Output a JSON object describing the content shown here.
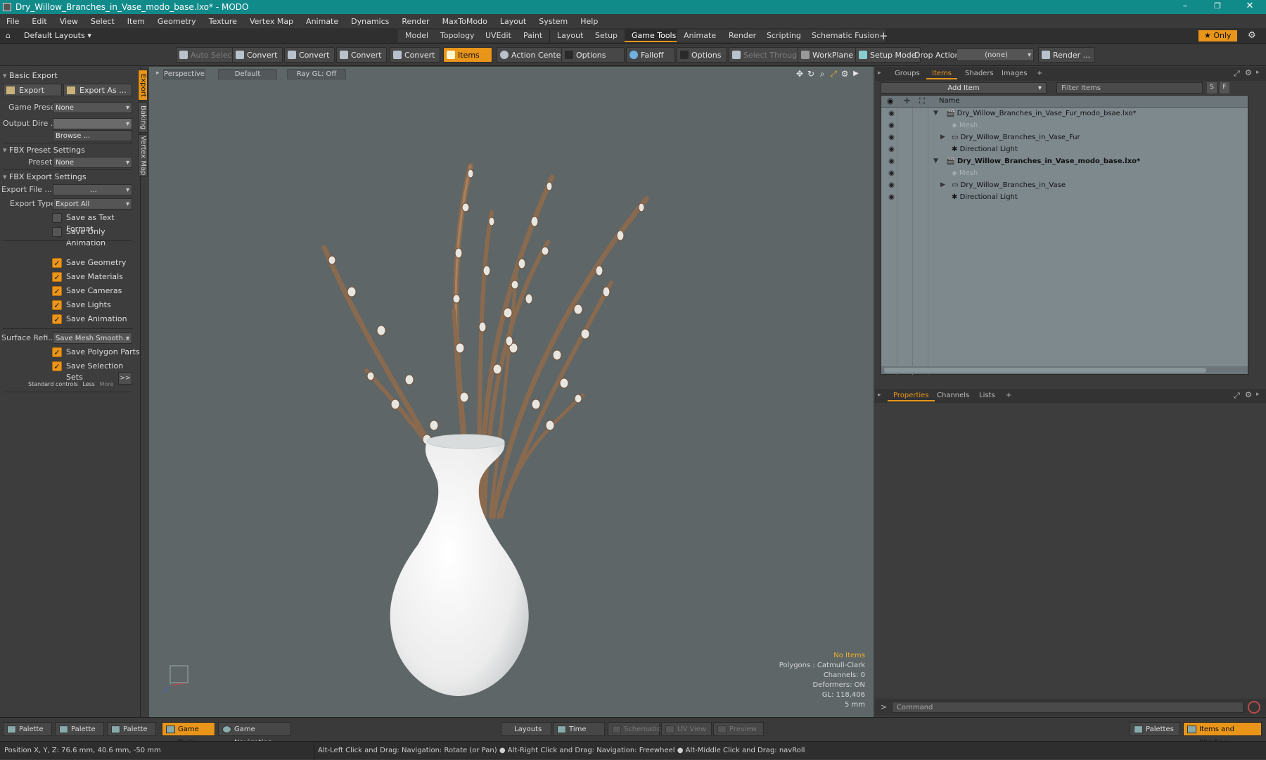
{
  "window": {
    "title": "Dry_Willow_Branches_in_Vase_modo_base.lxo* - MODO",
    "minimize": "–",
    "maximize": "❐",
    "close": "✕"
  },
  "menu": [
    "File",
    "Edit",
    "View",
    "Select",
    "Item",
    "Geometry",
    "Texture",
    "Vertex Map",
    "Animate",
    "Dynamics",
    "Render",
    "MaxToModo",
    "Layout",
    "System",
    "Help"
  ],
  "layout_bar": {
    "layouts_dropdown": "Default Layouts",
    "tabs": [
      "Model",
      "Topology",
      "UVEdit",
      "Paint",
      "Layout",
      "Setup",
      "Game Tools",
      "Animate",
      "Render",
      "Scripting",
      "Schematic Fusion"
    ],
    "active_tab": "Game Tools",
    "add_tab": "+",
    "only_button": "Only"
  },
  "toolbar": {
    "auto_select": "Auto Select",
    "convert_1": "Convert",
    "convert_2": "Convert",
    "convert_3": "Convert",
    "convert_4": "Convert",
    "items": "Items",
    "action_center": "Action Center",
    "options_1": "Options",
    "falloff": "Falloff",
    "options_2": "Options",
    "select_through": "Select Through",
    "workplane": "WorkPlane",
    "setup_mode": "Setup Mode",
    "drop_action_label": "Drop Action",
    "drop_action_value": "(none)",
    "render": "Render ..."
  },
  "left_panel": {
    "vertical_tabs": [
      "Export",
      "Baking",
      "Vertex Map"
    ],
    "basic_export": "Basic Export",
    "export_button": "Export",
    "export_as_button": "Export As ...",
    "game_preset_label": "Game Preset",
    "game_preset_value": "None",
    "output_dir_label": "Output Dire ...",
    "output_dir_value": "",
    "browse_button": "Browse ...",
    "fbx_preset_settings": "FBX Preset Settings",
    "preset_label": "Preset",
    "preset_value": "None",
    "fbx_export_settings": "FBX Export Settings",
    "export_file_label": "Export File",
    "export_file_value": "...",
    "export_type_label": "Export Type",
    "export_type_value": "Export All",
    "checkboxes_top": [
      {
        "label": "Save as Text Format",
        "checked": false
      },
      {
        "label": "Save Only Animation",
        "checked": false
      }
    ],
    "checkboxes_save": [
      {
        "label": "Save Geometry",
        "checked": true
      },
      {
        "label": "Save Materials",
        "checked": true
      },
      {
        "label": "Save Cameras",
        "checked": true
      },
      {
        "label": "Save Lights",
        "checked": true
      },
      {
        "label": "Save Animation",
        "checked": true
      }
    ],
    "surface_refine_label": "Surface Refi...",
    "surface_refine_value": "Save Mesh Smooth...",
    "checkboxes_bottom": [
      {
        "label": "Save Polygon Parts",
        "checked": true
      },
      {
        "label": "Save Selection Sets",
        "checked": true
      }
    ],
    "standard_controls": "Standard controls",
    "less": "Less",
    "more": "More",
    "expand": ">>"
  },
  "viewport": {
    "view_mode": "Perspective",
    "shading": "Default",
    "raygl": "Ray GL: Off",
    "stats": {
      "selection": "No Items",
      "polygons": "Polygons : Catmull-Clark",
      "channels": "Channels: 0",
      "deformers": "Deformers: ON",
      "gl": "GL: 118,406",
      "scale": "5 mm"
    }
  },
  "right_panel": {
    "top_tabs": [
      "Groups",
      "Items",
      "Shaders",
      "Images"
    ],
    "active_top_tab": "Items",
    "add_item": "Add Item",
    "filter_placeholder": "Filter Items",
    "filter_s": "S",
    "filter_f": "F",
    "name_header": "Name",
    "items": [
      {
        "name": "Dry_Willow_Branches_in_Vase_Fur_modo_bsae.lxo*",
        "level": 0,
        "twisty": "▼",
        "eye": true,
        "style": "normal"
      },
      {
        "name": "Mesh",
        "level": 1,
        "twisty": "",
        "eye": true,
        "style": "dim"
      },
      {
        "name": "Dry_Willow_Branches_in_Vase_Fur",
        "level": 1,
        "twisty": "▶",
        "eye": true,
        "style": "normal"
      },
      {
        "name": "Directional Light",
        "level": 1,
        "twisty": "",
        "eye": true,
        "style": "normal"
      },
      {
        "name": "Dry_Willow_Branches_in_Vase_modo_base.lxo*",
        "level": 0,
        "twisty": "▼",
        "eye": true,
        "style": "bold"
      },
      {
        "name": "Mesh",
        "level": 1,
        "twisty": "",
        "eye": true,
        "style": "dim"
      },
      {
        "name": "Dry_Willow_Branches_in_Vase",
        "level": 1,
        "twisty": "▶",
        "eye": true,
        "style": "normal"
      },
      {
        "name": "Directional Light",
        "level": 1,
        "twisty": "",
        "eye": true,
        "style": "normal"
      }
    ],
    "bottom_tabs": [
      "Properties",
      "Channels",
      "Lists"
    ],
    "active_bottom_tab": "Properties",
    "command_placeholder": "Command"
  },
  "bottom_bar": {
    "palette_1": "Palette",
    "palette_2": "Palette",
    "palette_3": "Palette",
    "game_tools": "Game Tools",
    "game_navigation": "Game Navigation",
    "layouts": "Layouts",
    "time": "Time",
    "schematic": "Schematic",
    "uv_view": "UV View",
    "preview": "Preview",
    "palettes": "Palettes",
    "items_and_shading": "Items and Shading"
  },
  "status_bar": {
    "position": "Position X, Y, Z:   76.6 mm, 40.6 mm, -50 mm",
    "hint_1": "Alt-Left Click and Drag: Navigation: Rotate (or Pan)",
    "hint_2": "Alt-Right Click and Drag: Navigation: Freewheel",
    "hint_3": "Alt-Middle Click and Drag: navRoll"
  },
  "colors": {
    "accent": "#e8951a",
    "titlebar": "#118a8a",
    "viewport_bg": "#5e6668",
    "branch": "#8a6a4e",
    "vase": "#f4f4f4"
  }
}
